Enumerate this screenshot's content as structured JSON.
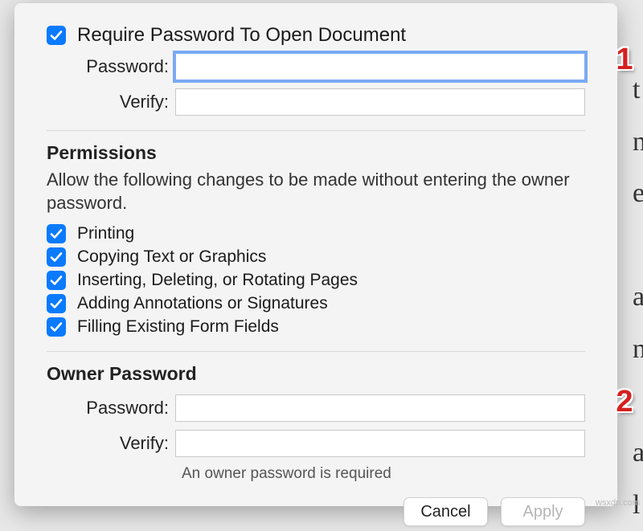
{
  "open_section": {
    "require_label": "Require Password To Open Document",
    "password_label": "Password:",
    "verify_label": "Verify:"
  },
  "permissions": {
    "title": "Permissions",
    "desc": "Allow the following changes to be made without entering the owner password.",
    "items": [
      {
        "label": "Printing"
      },
      {
        "label": "Copying Text or Graphics"
      },
      {
        "label": "Inserting, Deleting, or Rotating Pages"
      },
      {
        "label": "Adding Annotations or Signatures"
      },
      {
        "label": "Filling Existing Form Fields"
      }
    ]
  },
  "owner": {
    "title": "Owner Password",
    "password_label": "Password:",
    "verify_label": "Verify:",
    "helper": "An owner password is required"
  },
  "buttons": {
    "cancel": "Cancel",
    "apply": "Apply"
  },
  "annotations": {
    "badge1": "1",
    "badge2": "2"
  },
  "watermark": "wsxdn.com"
}
